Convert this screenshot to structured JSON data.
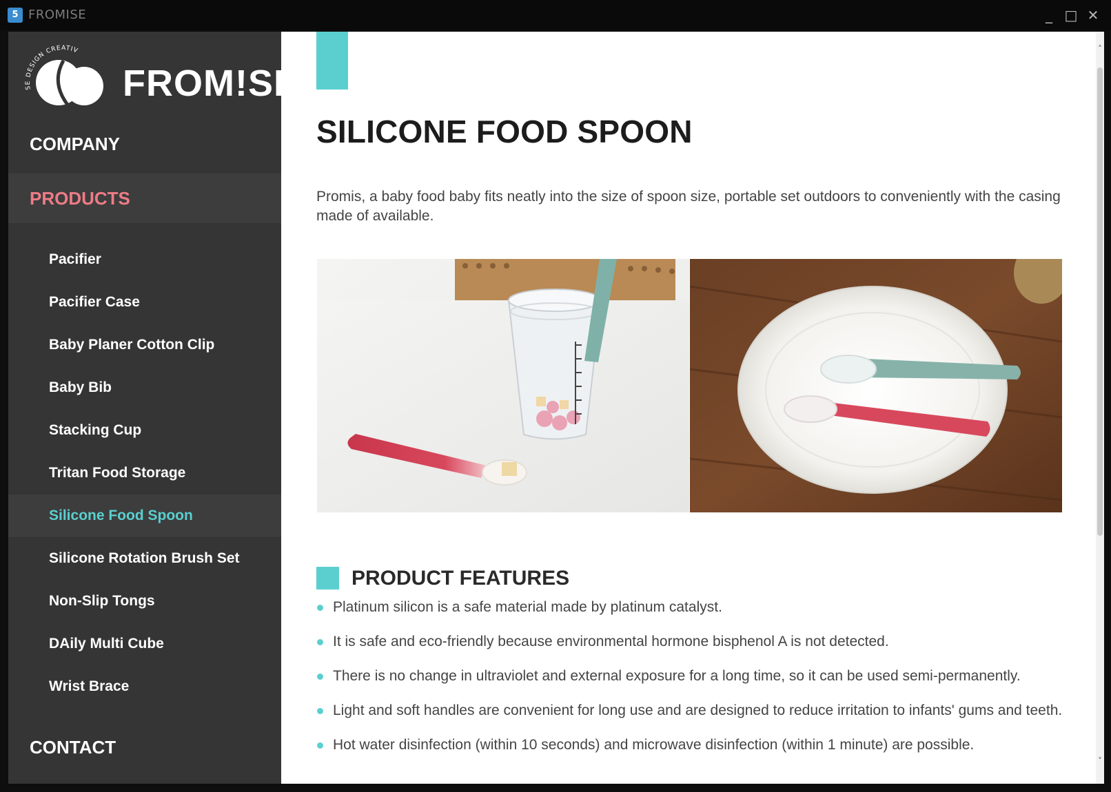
{
  "window": {
    "app_icon": "5",
    "title": "FROMISE",
    "controls": {
      "minimize": "_",
      "maximize": "□",
      "close": "✕"
    }
  },
  "sidebar": {
    "logo": {
      "text": "FROM!SE",
      "tagline": "SE DESIGN CREATIVE"
    },
    "company_label": "COMPANY",
    "products_label": "PRODUCTS",
    "products": [
      {
        "label": "Pacifier"
      },
      {
        "label": "Pacifier Case"
      },
      {
        "label": "Baby Planer Cotton Clip"
      },
      {
        "label": "Baby Bib"
      },
      {
        "label": "Stacking Cup"
      },
      {
        "label": "Tritan Food Storage"
      },
      {
        "label": "Silicone Food Spoon",
        "active": true
      },
      {
        "label": "Silicone Rotation Brush Set"
      },
      {
        "label": "Non-Slip Tongs"
      },
      {
        "label": "DAily Multi Cube"
      },
      {
        "label": "Wrist Brace"
      }
    ],
    "contact_label": "CONTACT"
  },
  "main": {
    "title": "SILICONE FOOD SPOON",
    "intro": "Promis, a baby food baby fits neatly into the size of spoon size, portable set outdoors to conveniently with the casing made of available.",
    "features_title": "PRODUCT FEATURES",
    "features": [
      "Platinum silicon is a safe material made by platinum catalyst.",
      "It is safe and eco-friendly because environmental hormone bisphenol A is not detected.",
      "There is no change in ultraviolet and external exposure for a long time, so it can be used semi-permanently.",
      "Light and soft handles are convenient for long use and are designed to reduce irritation to infants' gums and teeth.",
      "Hot water disinfection (within 10 seconds) and microwave disinfection (within 1 minute) are possible."
    ]
  },
  "colors": {
    "accent": "#5bcfcf",
    "products_highlight": "#ee7c86",
    "sidebar_bg": "#353535"
  }
}
